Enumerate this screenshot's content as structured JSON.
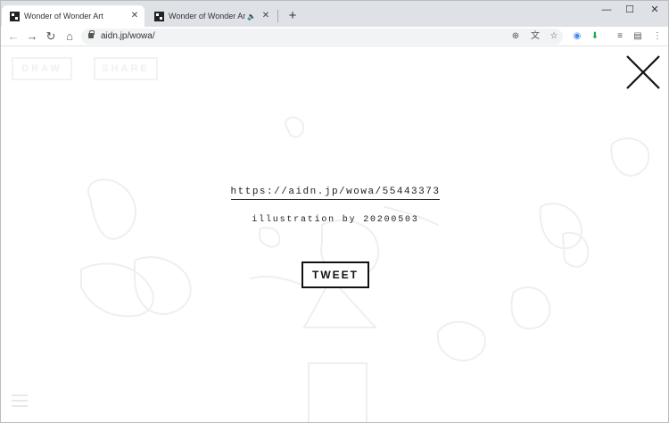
{
  "tabs": [
    {
      "title": "Wonder of Wonder Art",
      "close": "✕"
    },
    {
      "title": "Wonder of Wonder Art",
      "close": "✕",
      "audio": "🔈"
    }
  ],
  "new_tab": "+",
  "window": {
    "minimize": "—",
    "maximize": "☐",
    "close": "✕"
  },
  "toolbar": {
    "back": "←",
    "forward": "→",
    "reload": "↻",
    "home": "⌂",
    "url": "aidn.jp/wowa/",
    "add": "⊕",
    "translate": "文",
    "bookmark": "☆",
    "ext1": "◉",
    "ext2": "⬇",
    "reading": "≡",
    "ext3": "▤",
    "menu": "⋮"
  },
  "page": {
    "draw_label": "DRAW",
    "share_label": "SHARE",
    "share_url": "https://aidn.jp/wowa/55443373",
    "credit": "illustration by 20200503",
    "tweet_label": "TWEET",
    "close_icon": "close-icon",
    "menu_icon": "menu-icon"
  },
  "colors": {
    "tabstrip": "#dee1e6",
    "doodle": "#eeeeee",
    "ink": "#111111"
  }
}
